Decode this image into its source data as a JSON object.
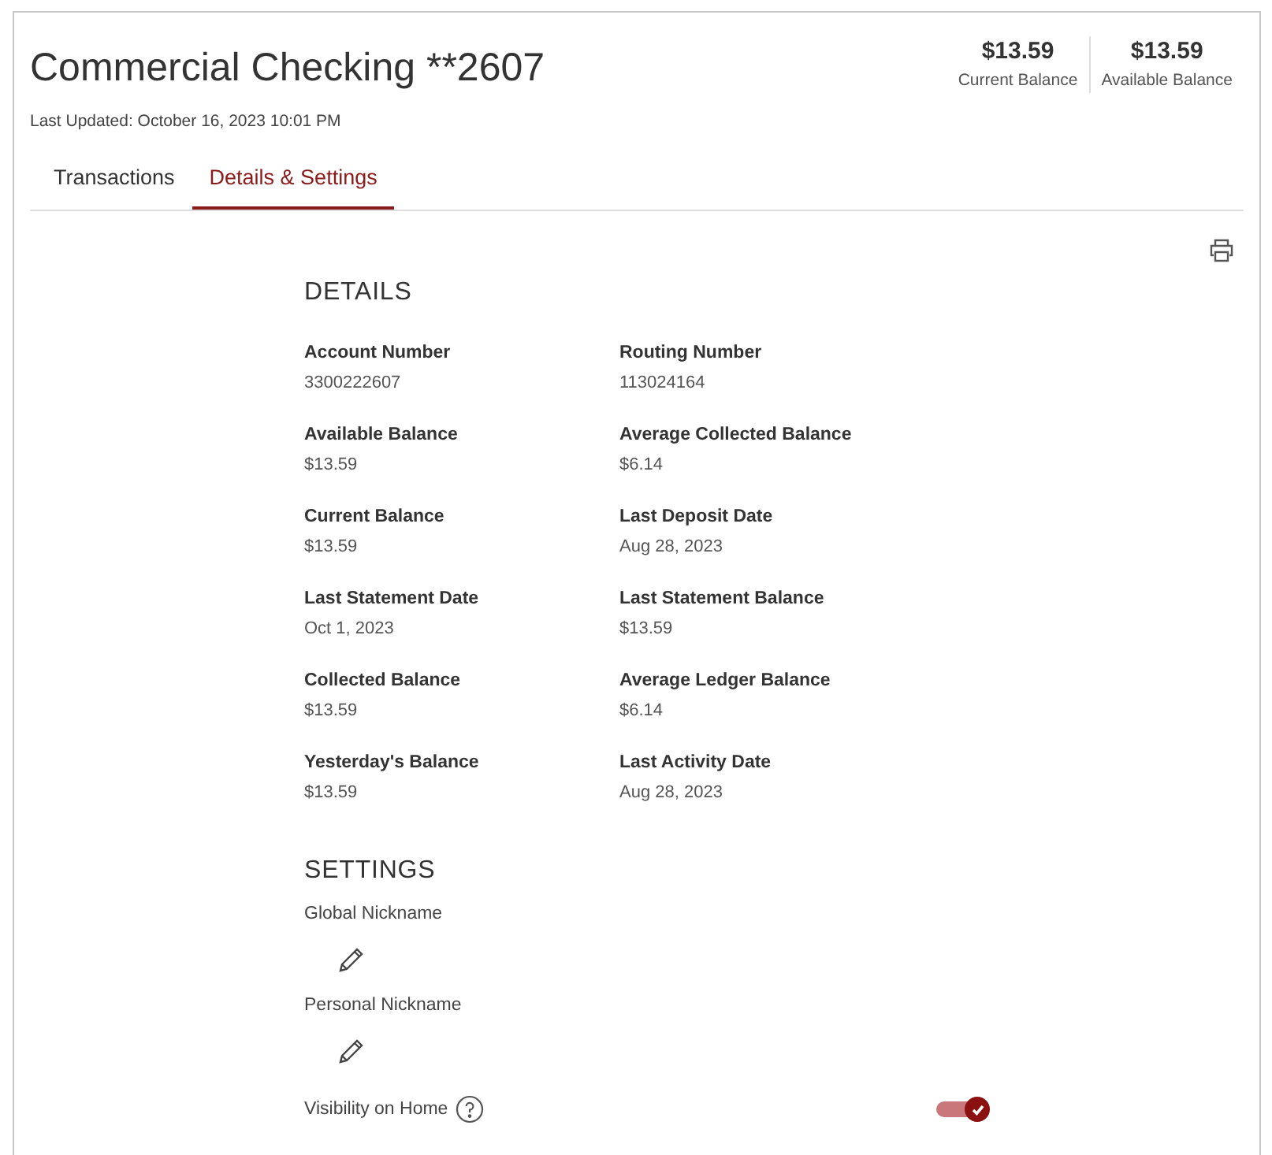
{
  "account": {
    "title": "Commercial Checking **2607",
    "last_updated": "Last Updated: October 16, 2023 10:01 PM"
  },
  "balances": [
    {
      "amount": "$13.59",
      "label": "Current Balance"
    },
    {
      "amount": "$13.59",
      "label": "Available Balance"
    }
  ],
  "tabs": [
    {
      "label": "Transactions",
      "selected": false
    },
    {
      "label": "Details & Settings",
      "selected": true
    }
  ],
  "details": {
    "heading": "DETAILS",
    "fields": [
      {
        "label": "Account Number",
        "value": "3300222607"
      },
      {
        "label": "Routing Number",
        "value": "113024164"
      },
      {
        "label": "Available Balance",
        "value": "$13.59"
      },
      {
        "label": "Average Collected Balance",
        "value": "$6.14"
      },
      {
        "label": "Current Balance",
        "value": "$13.59"
      },
      {
        "label": "Last Deposit Date",
        "value": "Aug 28, 2023"
      },
      {
        "label": "Last Statement Date",
        "value": "Oct 1, 2023"
      },
      {
        "label": "Last Statement Balance",
        "value": "$13.59"
      },
      {
        "label": "Collected Balance",
        "value": "$13.59"
      },
      {
        "label": "Average Ledger Balance",
        "value": "$6.14"
      },
      {
        "label": "Yesterday's Balance",
        "value": "$13.59"
      },
      {
        "label": "Last Activity Date",
        "value": "Aug 28, 2023"
      }
    ]
  },
  "settings": {
    "heading": "SETTINGS",
    "nicknames": [
      {
        "label": "Global Nickname"
      },
      {
        "label": "Personal Nickname"
      }
    ],
    "visibility": {
      "label": "Visibility on Home",
      "on": true
    }
  }
}
